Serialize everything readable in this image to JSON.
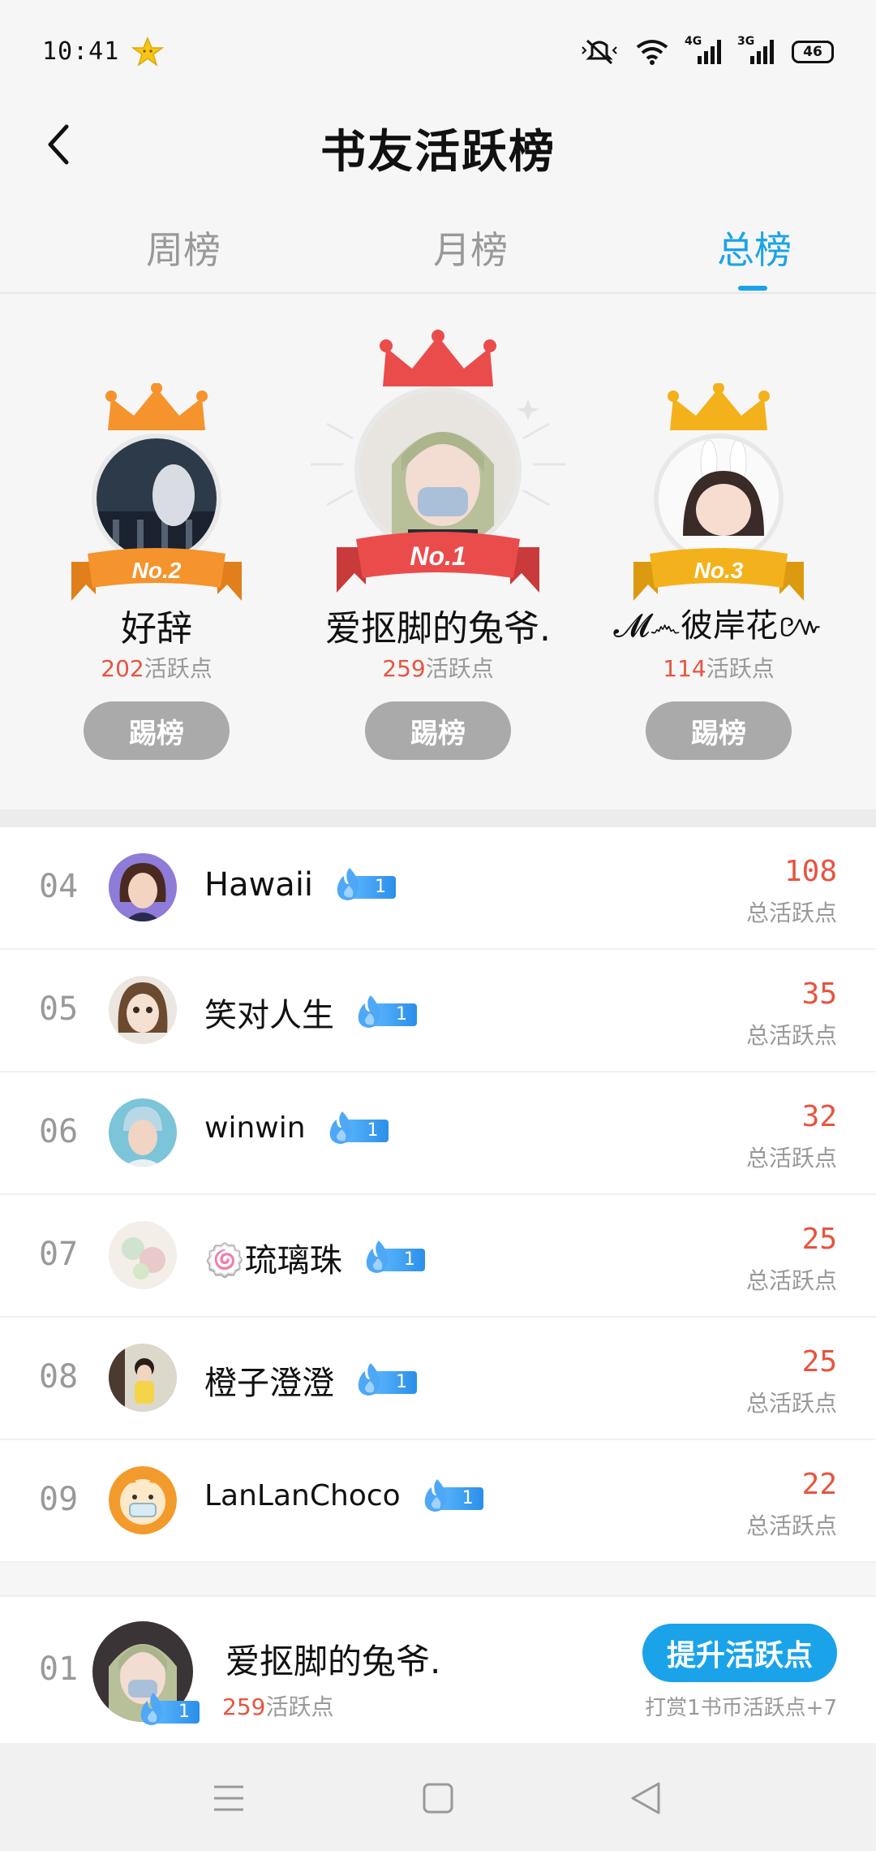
{
  "status_bar": {
    "time": "10:41",
    "signal_1_label": "4G",
    "signal_2_label": "3G",
    "battery": "46"
  },
  "header": {
    "title": "书友活跃榜"
  },
  "tabs": [
    {
      "label": "周榜",
      "active": false
    },
    {
      "label": "月榜",
      "active": false
    },
    {
      "label": "总榜",
      "active": true
    }
  ],
  "podium": {
    "first": {
      "rank_label": "No.1",
      "name": "爱抠脚的兔爷.",
      "points": "259",
      "points_unit": "活跃点",
      "button": "踢榜"
    },
    "second": {
      "rank_label": "No.2",
      "name": "好辞",
      "points": "202",
      "points_unit": "活跃点",
      "button": "踢榜"
    },
    "third": {
      "rank_label": "No.3",
      "name": "𝓜෴彼岸花៚",
      "points": "114",
      "points_unit": "活跃点",
      "button": "踢榜"
    }
  },
  "list": [
    {
      "rank": "04",
      "name": "Hawaii",
      "badge_level": "1",
      "score": "108",
      "score_label": "总活跃点"
    },
    {
      "rank": "05",
      "name": "笑对人生",
      "badge_level": "1",
      "score": "35",
      "score_label": "总活跃点"
    },
    {
      "rank": "06",
      "name": "winwin",
      "badge_level": "1",
      "score": "32",
      "score_label": "总活跃点"
    },
    {
      "rank": "07",
      "name": "🍥琉璃珠",
      "badge_level": "1",
      "score": "25",
      "score_label": "总活跃点"
    },
    {
      "rank": "08",
      "name": "橙子澄澄",
      "badge_level": "1",
      "score": "25",
      "score_label": "总活跃点"
    },
    {
      "rank": "09",
      "name": "LanLanChoco",
      "badge_level": "1",
      "score": "22",
      "score_label": "总活跃点"
    }
  ],
  "my_rank": {
    "rank": "01",
    "name": "爱抠脚的兔爷.",
    "badge_level": "1",
    "points": "259",
    "points_unit": "活跃点",
    "button": "提升活跃点",
    "hint": "打赏1书币活跃点+7"
  },
  "colors": {
    "accent": "#1aa3e8",
    "score_red": "#e8533f",
    "gold": "#f3b21c",
    "orange": "#f5932c",
    "red": "#ea4c4c"
  }
}
